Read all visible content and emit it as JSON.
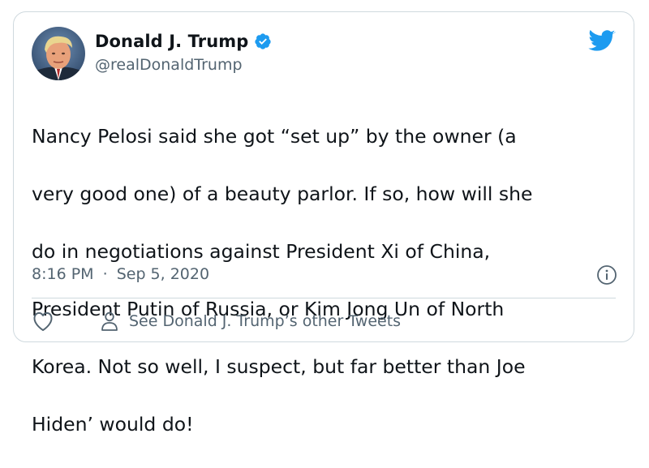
{
  "author": {
    "display_name": "Donald J. Trump",
    "handle": "@realDonaldTrump",
    "verified": true,
    "avatar_icon": "profile-photo"
  },
  "tweet": {
    "lines": [
      "Nancy Pelosi said she got “set up” by the owner (a",
      "very good one) of a beauty parlor. If so, how will she",
      "do in negotiations against President Xi of China,",
      "President Putin of Russia, or Kim Jong Un of North",
      "Korea. Not so well, I suspect, but far better than Joe",
      "Hiden’ would do!"
    ],
    "time": "8:16 PM",
    "separator": "·",
    "date": "Sep 5, 2020"
  },
  "actions": {
    "other_tweets_label": "See Donald J. Trump’s other Tweets"
  },
  "icons": {
    "brand": "twitter-bird-icon",
    "info": "info-icon",
    "like": "heart-icon",
    "profile": "person-icon"
  },
  "colors": {
    "brand_blue": "#1d9bf0",
    "text_primary": "#0f1419",
    "text_secondary": "#536471",
    "border": "#cfd9de"
  }
}
